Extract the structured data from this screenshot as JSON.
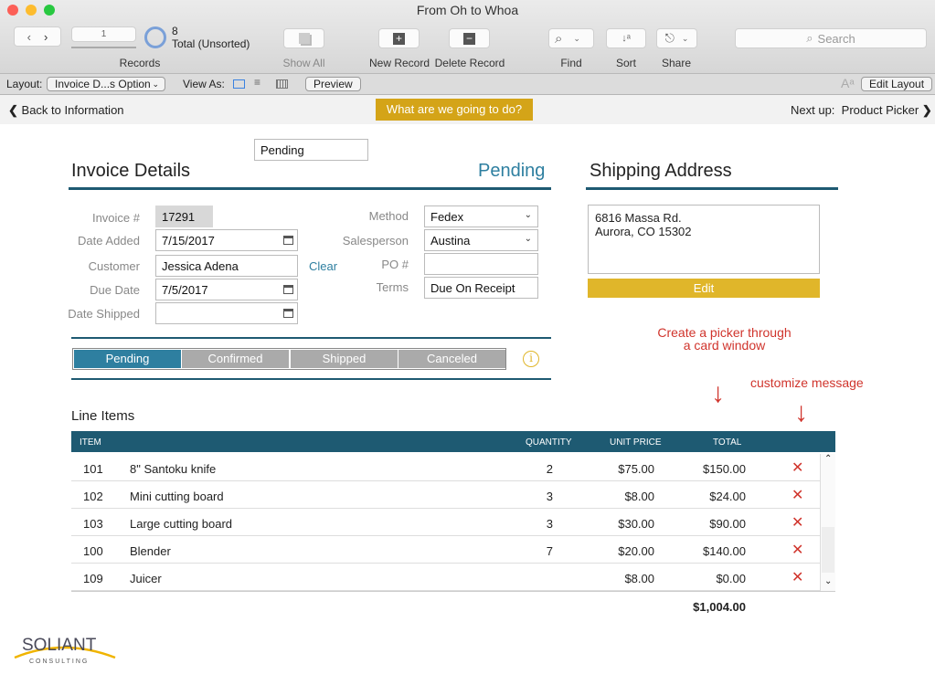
{
  "window": {
    "title": "From Oh to Whoa"
  },
  "toolbar": {
    "record_current": "1",
    "records_label": "Records",
    "found_count": "8",
    "total_label": "Total (Unsorted)",
    "show_all": "Show All",
    "new_record": "New Record",
    "delete_record": "Delete Record",
    "find": "Find",
    "sort": "Sort",
    "share": "Share",
    "search_placeholder": "Search"
  },
  "layoutbar": {
    "layout_label": "Layout:",
    "layout_value": "Invoice D...s Option",
    "view_as": "View As:",
    "preview": "Preview",
    "edit_layout": "Edit Layout"
  },
  "nav": {
    "back": "Back to Information",
    "center_button": "What are we going to do?",
    "next_label": "Next up:",
    "next_value": "Product Picker"
  },
  "invoice": {
    "status_field": "Pending",
    "title": "Invoice Details",
    "status_display": "Pending",
    "fields": {
      "invoice_label": "Invoice #",
      "invoice_value": "17291",
      "date_added_label": "Date Added",
      "date_added_value": "7/15/2017",
      "customer_label": "Customer",
      "customer_value": "Jessica Adena",
      "clear": "Clear",
      "due_date_label": "Due Date",
      "due_date_value": "7/5/2017",
      "date_shipped_label": "Date Shipped",
      "date_shipped_value": "",
      "method_label": "Method",
      "method_value": "Fedex",
      "salesperson_label": "Salesperson",
      "salesperson_value": "Austina",
      "po_label": "PO #",
      "po_value": "",
      "terms_label": "Terms",
      "terms_value": "Due On Receipt"
    },
    "status_tabs": [
      "Pending",
      "Confirmed",
      "Shipped",
      "Canceled"
    ],
    "active_tab": "Pending"
  },
  "shipping": {
    "title": "Shipping Address",
    "line1": "6816 Massa Rd.",
    "line2": "Aurora, CO 15302",
    "edit": "Edit"
  },
  "annotations": {
    "picker_line1": "Create a picker through",
    "picker_line2": "a card window",
    "customize": "customize message"
  },
  "line_items": {
    "title": "Line Items",
    "headers": {
      "item": "ITEM",
      "quantity": "QUANTITY",
      "unit_price": "UNIT PRICE",
      "total": "TOTAL"
    },
    "rows": [
      {
        "item": "101",
        "name": "8\" Santoku knife",
        "qty": "2",
        "price": "$75.00",
        "total": "$150.00"
      },
      {
        "item": "102",
        "name": "Mini cutting board",
        "qty": "3",
        "price": "$8.00",
        "total": "$24.00"
      },
      {
        "item": "103",
        "name": "Large cutting board",
        "qty": "3",
        "price": "$30.00",
        "total": "$90.00"
      },
      {
        "item": "100",
        "name": "Blender",
        "qty": "7",
        "price": "$20.00",
        "total": "$140.00"
      },
      {
        "item": "109",
        "name": "Juicer",
        "qty": "",
        "price": "$8.00",
        "total": "$0.00"
      }
    ],
    "grand_total": "$1,004.00"
  },
  "logo": {
    "text": "SOLIANT",
    "sub": "CONSULTING"
  },
  "colors": {
    "accent": "#1e5a72",
    "teal": "#2e7fa0",
    "gold": "#e0b62a",
    "red": "#d0342c"
  }
}
